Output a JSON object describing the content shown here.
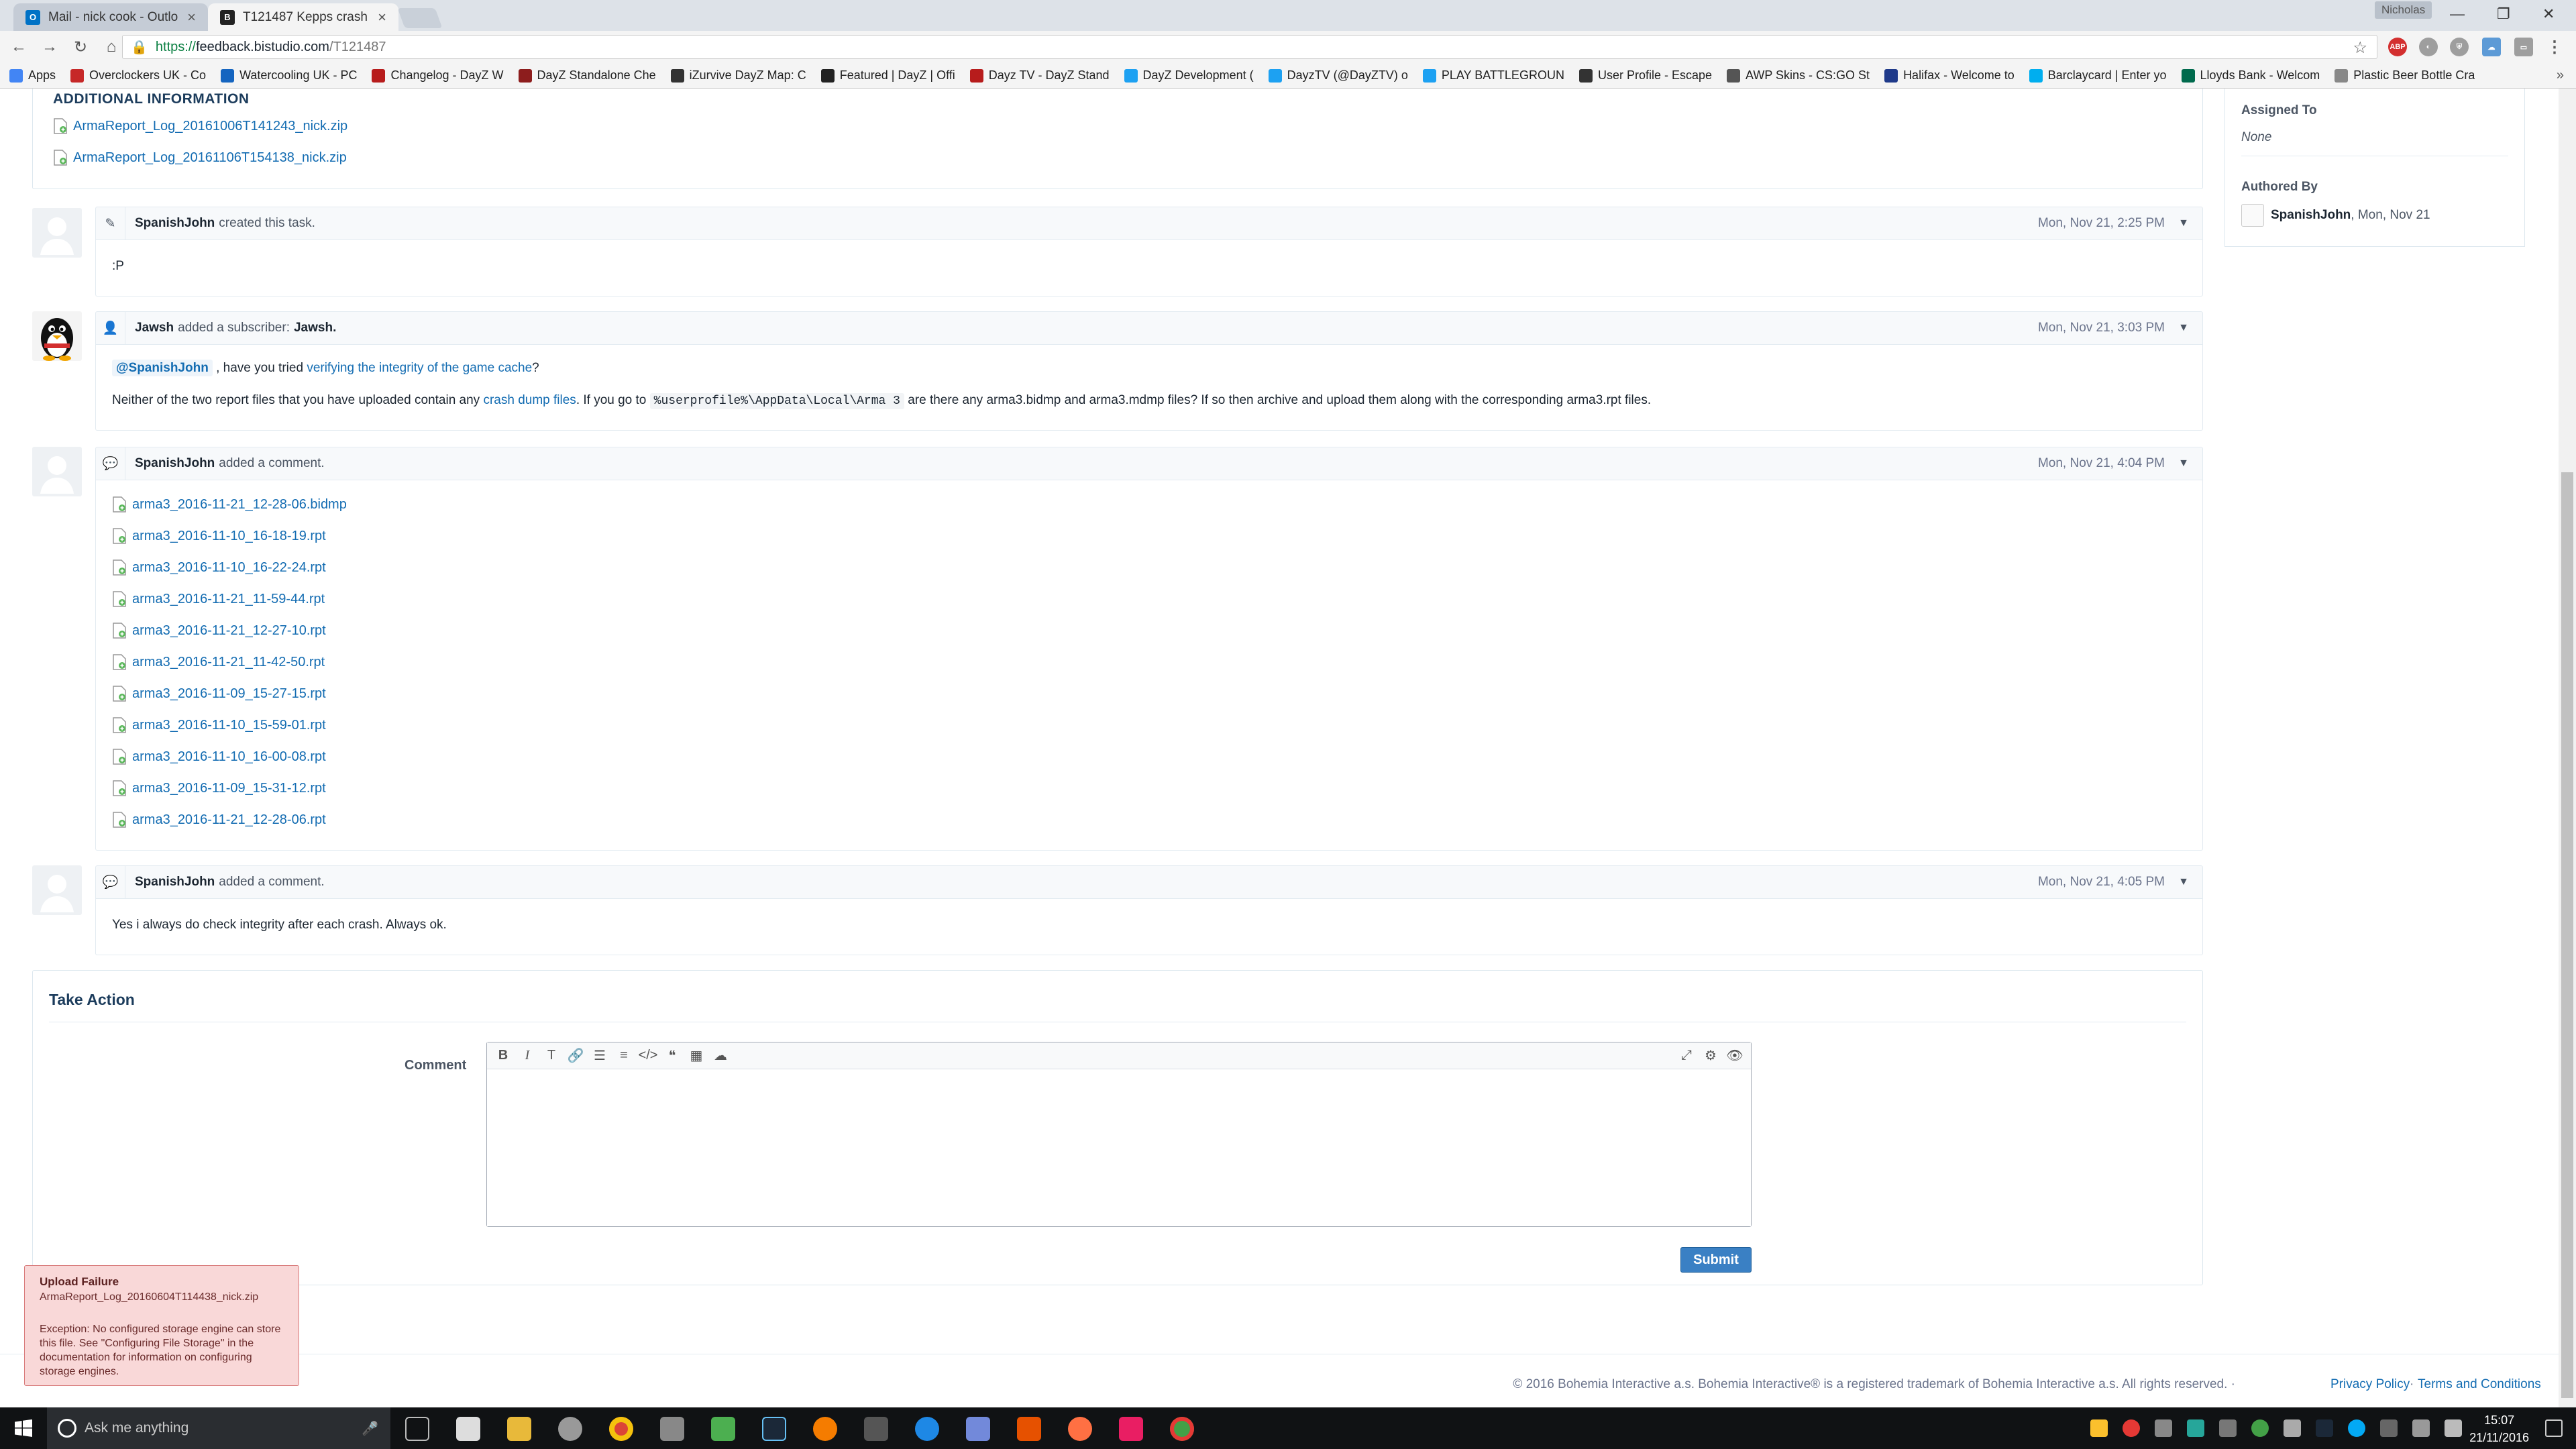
{
  "browser": {
    "tabs": [
      {
        "title": "Mail - nick cook - Outlo",
        "active": false,
        "icon": "outlook-icon"
      },
      {
        "title": "T121487 Kepps crash",
        "active": true,
        "icon": "bohemia-icon"
      }
    ],
    "user": "Nicholas",
    "url_scheme": "https://",
    "url_host": "feedback.bistudio.com",
    "url_path": "/T121487",
    "bookmarks": [
      {
        "label": "Apps",
        "color": "#4285f4"
      },
      {
        "label": "Overclockers UK - Co",
        "color": "#c62828"
      },
      {
        "label": "Watercooling UK - PC",
        "color": "#1565c0"
      },
      {
        "label": "Changelog - DayZ W",
        "color": "#b71c1c"
      },
      {
        "label": "DayZ Standalone Che",
        "color": "#8d1d1d"
      },
      {
        "label": "iZurvive DayZ Map: C",
        "color": "#333333"
      },
      {
        "label": "Featured | DayZ | Offi",
        "color": "#222222"
      },
      {
        "label": "Dayz TV - DayZ Stand",
        "color": "#b71c1c"
      },
      {
        "label": "DayZ Development (",
        "color": "#1da1f2"
      },
      {
        "label": "DayzTV (@DayZTV) o",
        "color": "#1da1f2"
      },
      {
        "label": "PLAY BATTLEGROUN",
        "color": "#1da1f2"
      },
      {
        "label": "User Profile - Escape",
        "color": "#333333"
      },
      {
        "label": "AWP Skins - CS:GO St",
        "color": "#555555"
      },
      {
        "label": "Halifax - Welcome to",
        "color": "#1f3a8a"
      },
      {
        "label": "Barclaycard | Enter yo",
        "color": "#00aeef"
      },
      {
        "label": "Lloyds Bank - Welcom",
        "color": "#006a4d"
      },
      {
        "label": "Plastic Beer Bottle Cra",
        "color": "#888888"
      }
    ]
  },
  "task": {
    "additional_info_title": "ADDITIONAL INFORMATION",
    "attachments": [
      "ArmaReport_Log_20161006T141243_nick.zip",
      "ArmaReport_Log_20161106T154138_nick.zip"
    ],
    "sidebar": {
      "assigned_label": "Assigned To",
      "assigned_value": "None",
      "authored_label": "Authored By",
      "authored_user": "SpanishJohn",
      "authored_date": ", Mon, Nov 21"
    },
    "events": [
      {
        "user": "SpanishJohn",
        "action": "created this task.",
        "timestamp": "Mon, Nov 21, 2:25 PM",
        "body": ":P"
      },
      {
        "user": "Jawsh",
        "action": "added a subscriber:",
        "subscriber": "Jawsh.",
        "timestamp": "Mon, Nov 21, 3:03 PM",
        "line1_mention": "@SpanishJohn",
        "line1_text": ", have you tried",
        "line1_link": "verifying the integrity of the game cache",
        "line1_end": "?",
        "line2_start": "Neither of the two report files that you have uploaded contain any",
        "line2_link": "crash dump files",
        "line2_mid": ". If you go to",
        "line2_code": "%userprofile%\\AppData\\Local\\Arma 3",
        "line2_end": "are there any arma3.bidmp and arma3.mdmp files? If so then archive and upload them along with the corresponding arma3.rpt files."
      },
      {
        "user": "SpanishJohn",
        "action": "added a comment.",
        "timestamp": "Mon, Nov 21, 4:04 PM",
        "files": [
          "arma3_2016-11-21_12-28-06.bidmp",
          "arma3_2016-11-10_16-18-19.rpt",
          "arma3_2016-11-10_16-22-24.rpt",
          "arma3_2016-11-21_11-59-44.rpt",
          "arma3_2016-11-21_12-27-10.rpt",
          "arma3_2016-11-21_11-42-50.rpt",
          "arma3_2016-11-09_15-27-15.rpt",
          "arma3_2016-11-10_15-59-01.rpt",
          "arma3_2016-11-10_16-00-08.rpt",
          "arma3_2016-11-09_15-31-12.rpt",
          "arma3_2016-11-21_12-28-06.rpt"
        ]
      },
      {
        "user": "SpanishJohn",
        "action": "added a comment.",
        "timestamp": "Mon, Nov 21, 4:05 PM",
        "body": "Yes i always do check integrity after each crash. Always ok."
      }
    ],
    "take_action": {
      "title": "Take Action",
      "comment_label": "Comment",
      "submit_label": "Submit"
    }
  },
  "toast": {
    "title": "Upload Failure",
    "file": "ArmaReport_Log_20160604T114438_nick.zip",
    "message": "Exception: No configured storage engine can store this file. See \"Configuring File Storage\" in the documentation for information on configuring storage engines."
  },
  "footer": {
    "text": "© 2016 Bohemia Interactive a.s. Bohemia Interactive® is a registered trademark of Bohemia Interactive a.s. All rights reserved. ·",
    "privacy": "Privacy Policy",
    "sep": "·",
    "terms": "Terms and Conditions"
  },
  "taskbar": {
    "search_placeholder": "Ask me anything",
    "time": "15:07",
    "date": "21/11/2016"
  }
}
